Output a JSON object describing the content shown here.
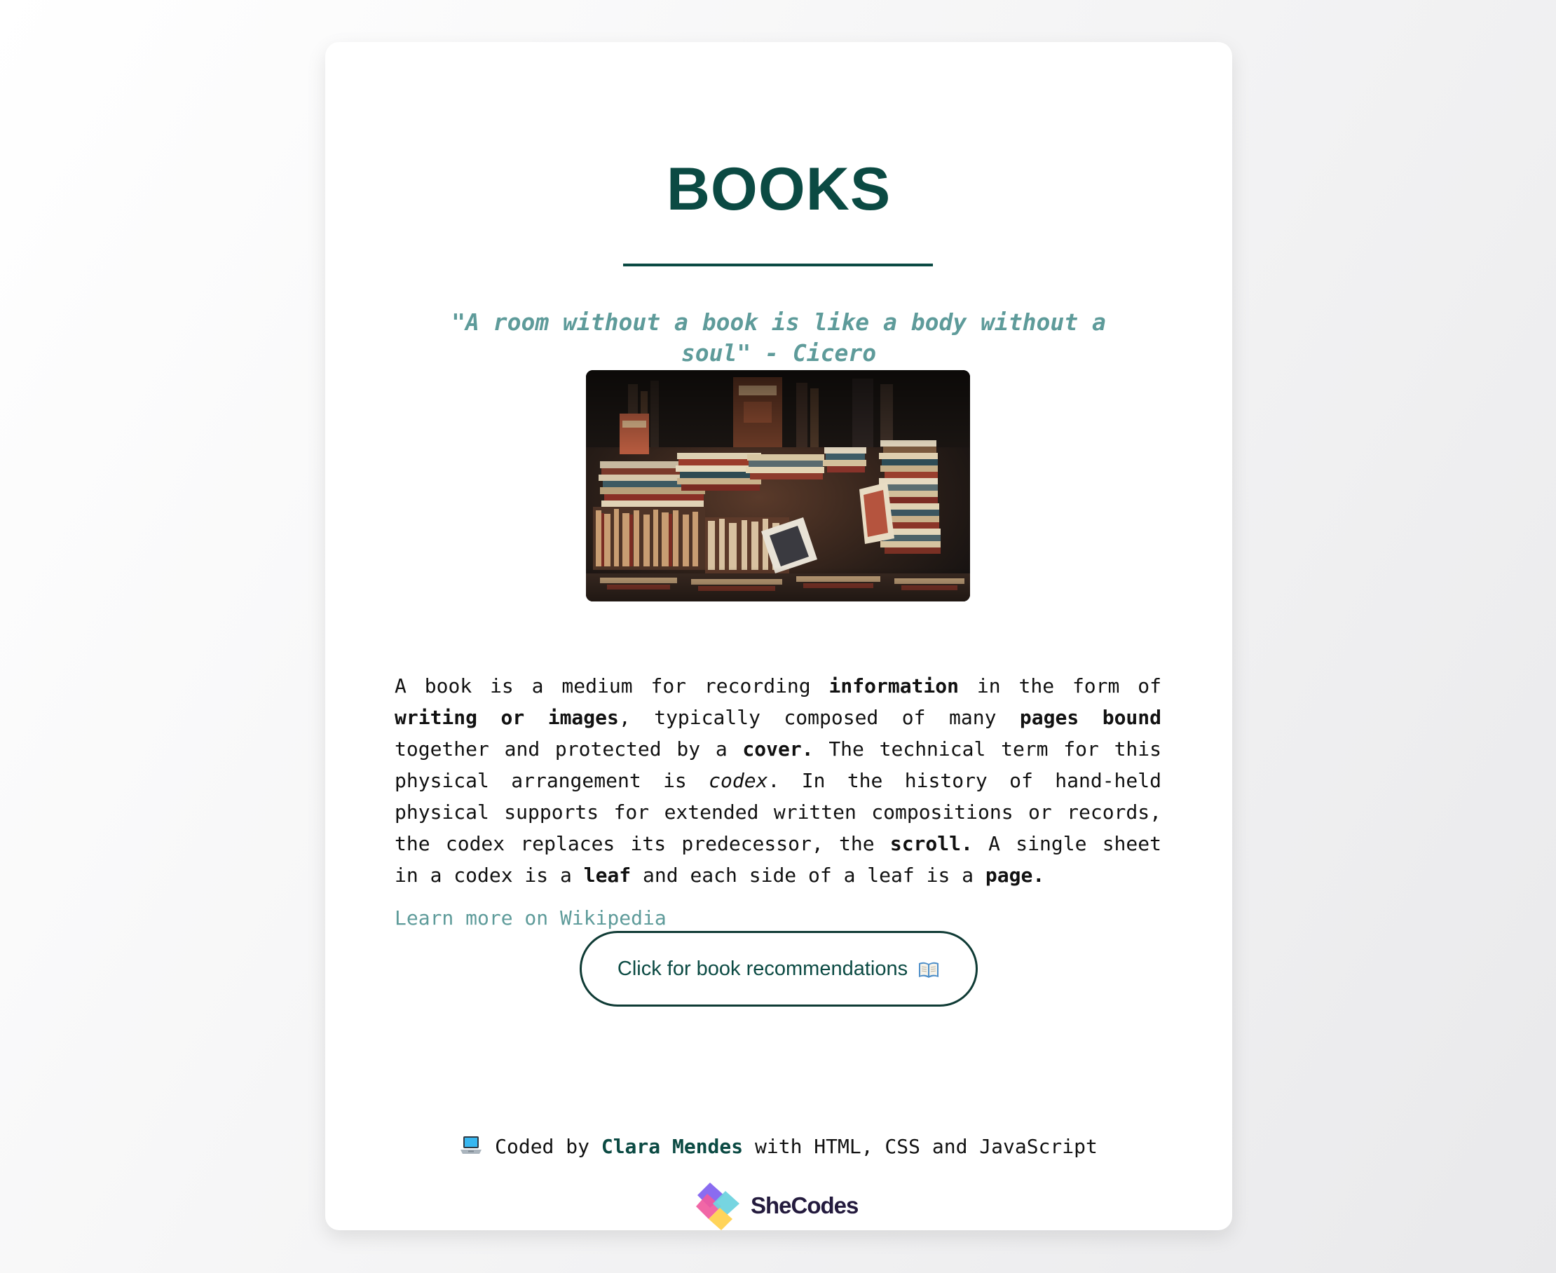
{
  "page": {
    "title": "BOOKS",
    "quote": "\"A room without a book is like a body without a soul\" - Cicero",
    "description": [
      {
        "text": "A book is a medium for recording ",
        "style": "normal"
      },
      {
        "text": "information",
        "style": "bold"
      },
      {
        "text": " in the form of ",
        "style": "normal"
      },
      {
        "text": "writing or images",
        "style": "bold"
      },
      {
        "text": ", typically composed of many ",
        "style": "normal"
      },
      {
        "text": "pages bound",
        "style": "bold"
      },
      {
        "text": " together and protected by a ",
        "style": "normal"
      },
      {
        "text": "cover.",
        "style": "bold"
      },
      {
        "text": " The technical term for this physical arrangement is ",
        "style": "normal"
      },
      {
        "text": "codex",
        "style": "italic"
      },
      {
        "text": ". In the history of hand-held physical supports for extended written compositions or records, the codex replaces its predecessor, the ",
        "style": "normal"
      },
      {
        "text": "scroll.",
        "style": "bold"
      },
      {
        "text": " A single sheet in a codex is a ",
        "style": "normal"
      },
      {
        "text": "leaf",
        "style": "bold"
      },
      {
        "text": " and each side of a leaf is a ",
        "style": "normal"
      },
      {
        "text": "page.",
        "style": "bold"
      }
    ],
    "wiki_link": "Learn more on Wikipedia",
    "button_label": "Click for book recommendations",
    "button_icon": "open-book-icon",
    "footer": {
      "icon": "laptop-icon",
      "prefix": "Coded by",
      "author": "Clara Mendes",
      "suffix": "with HTML, CSS and JavaScript"
    },
    "logo_text": "SheCodes"
  },
  "colors": {
    "primary": "#0b4a43",
    "quote": "#5e9b9a",
    "link": "#5e9b9a",
    "text": "#111111",
    "logo_text": "#231a3d",
    "logo_pink": "#f05a9e",
    "logo_purple": "#8a6cf0",
    "logo_teal": "#6fd3df",
    "logo_yellow": "#ffd45a"
  }
}
